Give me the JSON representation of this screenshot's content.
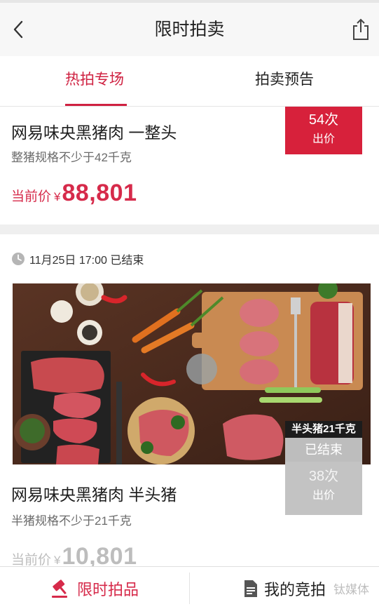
{
  "header": {
    "title": "限时拍卖",
    "back_icon": "chevron-left-icon",
    "share_icon": "share-icon"
  },
  "tabs": [
    {
      "label": "热拍专场",
      "active": true
    },
    {
      "label": "拍卖预告",
      "active": false
    }
  ],
  "items": [
    {
      "title": "网易味央黑猪肉 一整头",
      "spec": "整猪规格不少于42千克",
      "price_label": "当前价",
      "currency": "¥",
      "price": "88,801",
      "bid_count": "54次",
      "bid_label": "出价"
    },
    {
      "time_status": "11月25日 17:00 已结束",
      "weight_tag": "半头猪21千克",
      "status_badge": "已结束",
      "title": "网易味央黑猪肉 半头猪",
      "spec": "半猪规格不少于21千克",
      "price_label": "当前价",
      "currency": "¥",
      "price": "10,801",
      "bid_count": "38次",
      "bid_label": "出价"
    }
  ],
  "tabbar": {
    "items": [
      {
        "label": "限时拍品",
        "icon": "gavel-icon",
        "active": true
      },
      {
        "label": "我的竞拍",
        "icon": "document-icon",
        "active": false
      }
    ],
    "watermark": "钛媒体"
  },
  "colors": {
    "accent": "#d62a4a",
    "bid_active": "#d7213b",
    "bid_ended": "#c3c3c3"
  }
}
